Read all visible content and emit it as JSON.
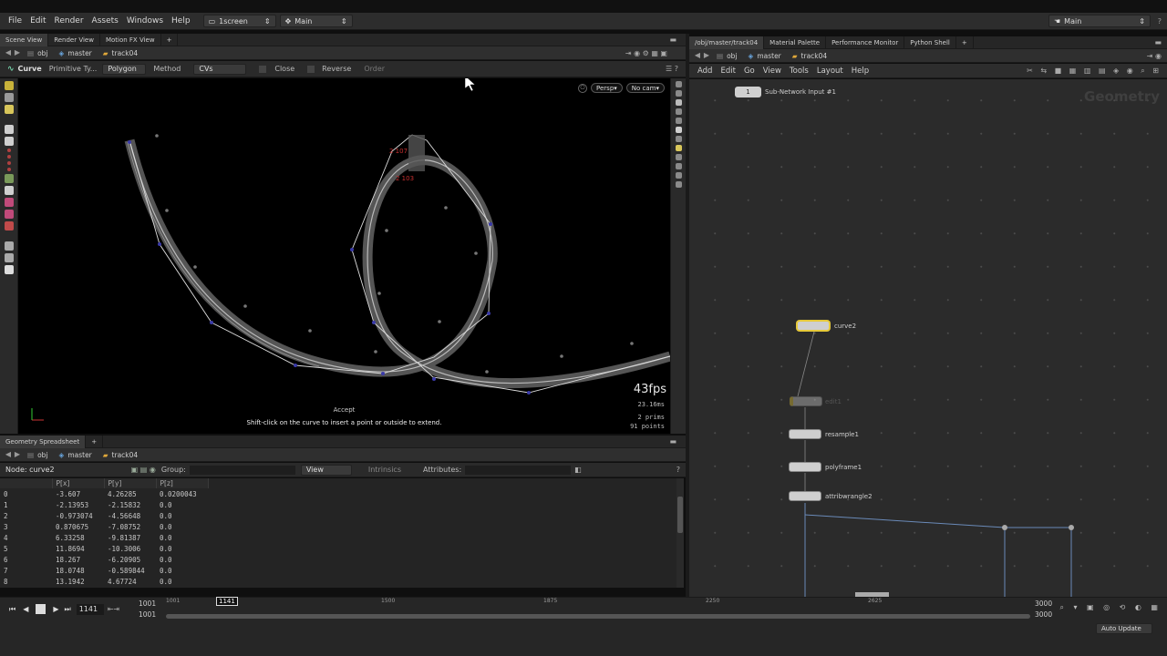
{
  "menu": {
    "items": [
      "File",
      "Edit",
      "Render",
      "Assets",
      "Windows",
      "Help"
    ],
    "desktop": "1screen",
    "context": "Main",
    "right_desktop": "Main"
  },
  "scene": {
    "tabs": [
      "Scene View",
      "Render View",
      "Motion FX View"
    ],
    "path": [
      "obj",
      "master",
      "track04"
    ],
    "op": {
      "name": "Curve",
      "primitive": "Primitive Ty...",
      "primitive_value": "Polygon",
      "method_label": "Method",
      "method_value": "CVs",
      "close": "Close",
      "reverse": "Reverse",
      "order": "Order"
    },
    "persp": "Persp",
    "cam": "No cam",
    "hint_title": "Accept",
    "hint": "Shift-click on the curve to insert a point or outside to extend.",
    "fps": "43fps",
    "ms": "23.16ms",
    "prims": "2  prims",
    "points": "91 points",
    "point_labels": [
      "2 107",
      "2 103"
    ]
  },
  "spreadsheet": {
    "tab": "Geometry Spreadsheet",
    "path": [
      "obj",
      "master",
      "track04"
    ],
    "node_label": "Node: curve2",
    "group_label": "Group:",
    "view": "View",
    "intrinsics": "Intrinsics",
    "attributes": "Attributes:",
    "columns": [
      "",
      "P[x]",
      "P[y]",
      "P[z]"
    ],
    "rows": [
      [
        "0",
        "-3.607",
        "4.26285",
        "0.0200043"
      ],
      [
        "1",
        "-2.13953",
        "-2.15832",
        "0.0"
      ],
      [
        "2",
        "-0.973074",
        "-4.56648",
        "0.0"
      ],
      [
        "3",
        "0.870675",
        "-7.08752",
        "0.0"
      ],
      [
        "4",
        "6.33258",
        "-9.81387",
        "0.0"
      ],
      [
        "5",
        "11.8694",
        "-10.3006",
        "0.0"
      ],
      [
        "6",
        "18.267",
        "-6.20905",
        "0.0"
      ],
      [
        "7",
        "18.0748",
        "-0.589844",
        "0.0"
      ],
      [
        "8",
        "13.1942",
        "4.67724",
        "0.0"
      ]
    ]
  },
  "network": {
    "tabs": [
      "/obj/master/track04",
      "Material Palette",
      "Performance Monitor",
      "Python Shell"
    ],
    "path": [
      "obj",
      "master",
      "track04"
    ],
    "menu": [
      "Add",
      "Edit",
      "Go",
      "View",
      "Tools",
      "Layout",
      "Help"
    ],
    "watermark": "Geometry",
    "subnet_index": "1",
    "subnet_label": "Sub-Network Input #1",
    "nodes": [
      "curve2",
      "edit1",
      "resample1",
      "polyframe1",
      "attribwrangle2"
    ]
  },
  "timeline": {
    "frame": "1141",
    "start": "1001",
    "start2": "1001",
    "end": "3000",
    "end2": "3000",
    "ticks": [
      "1001",
      "1500",
      "1875",
      "2250",
      "2625"
    ],
    "marker": "1141"
  },
  "status": {
    "auto_update": "Auto Update"
  }
}
